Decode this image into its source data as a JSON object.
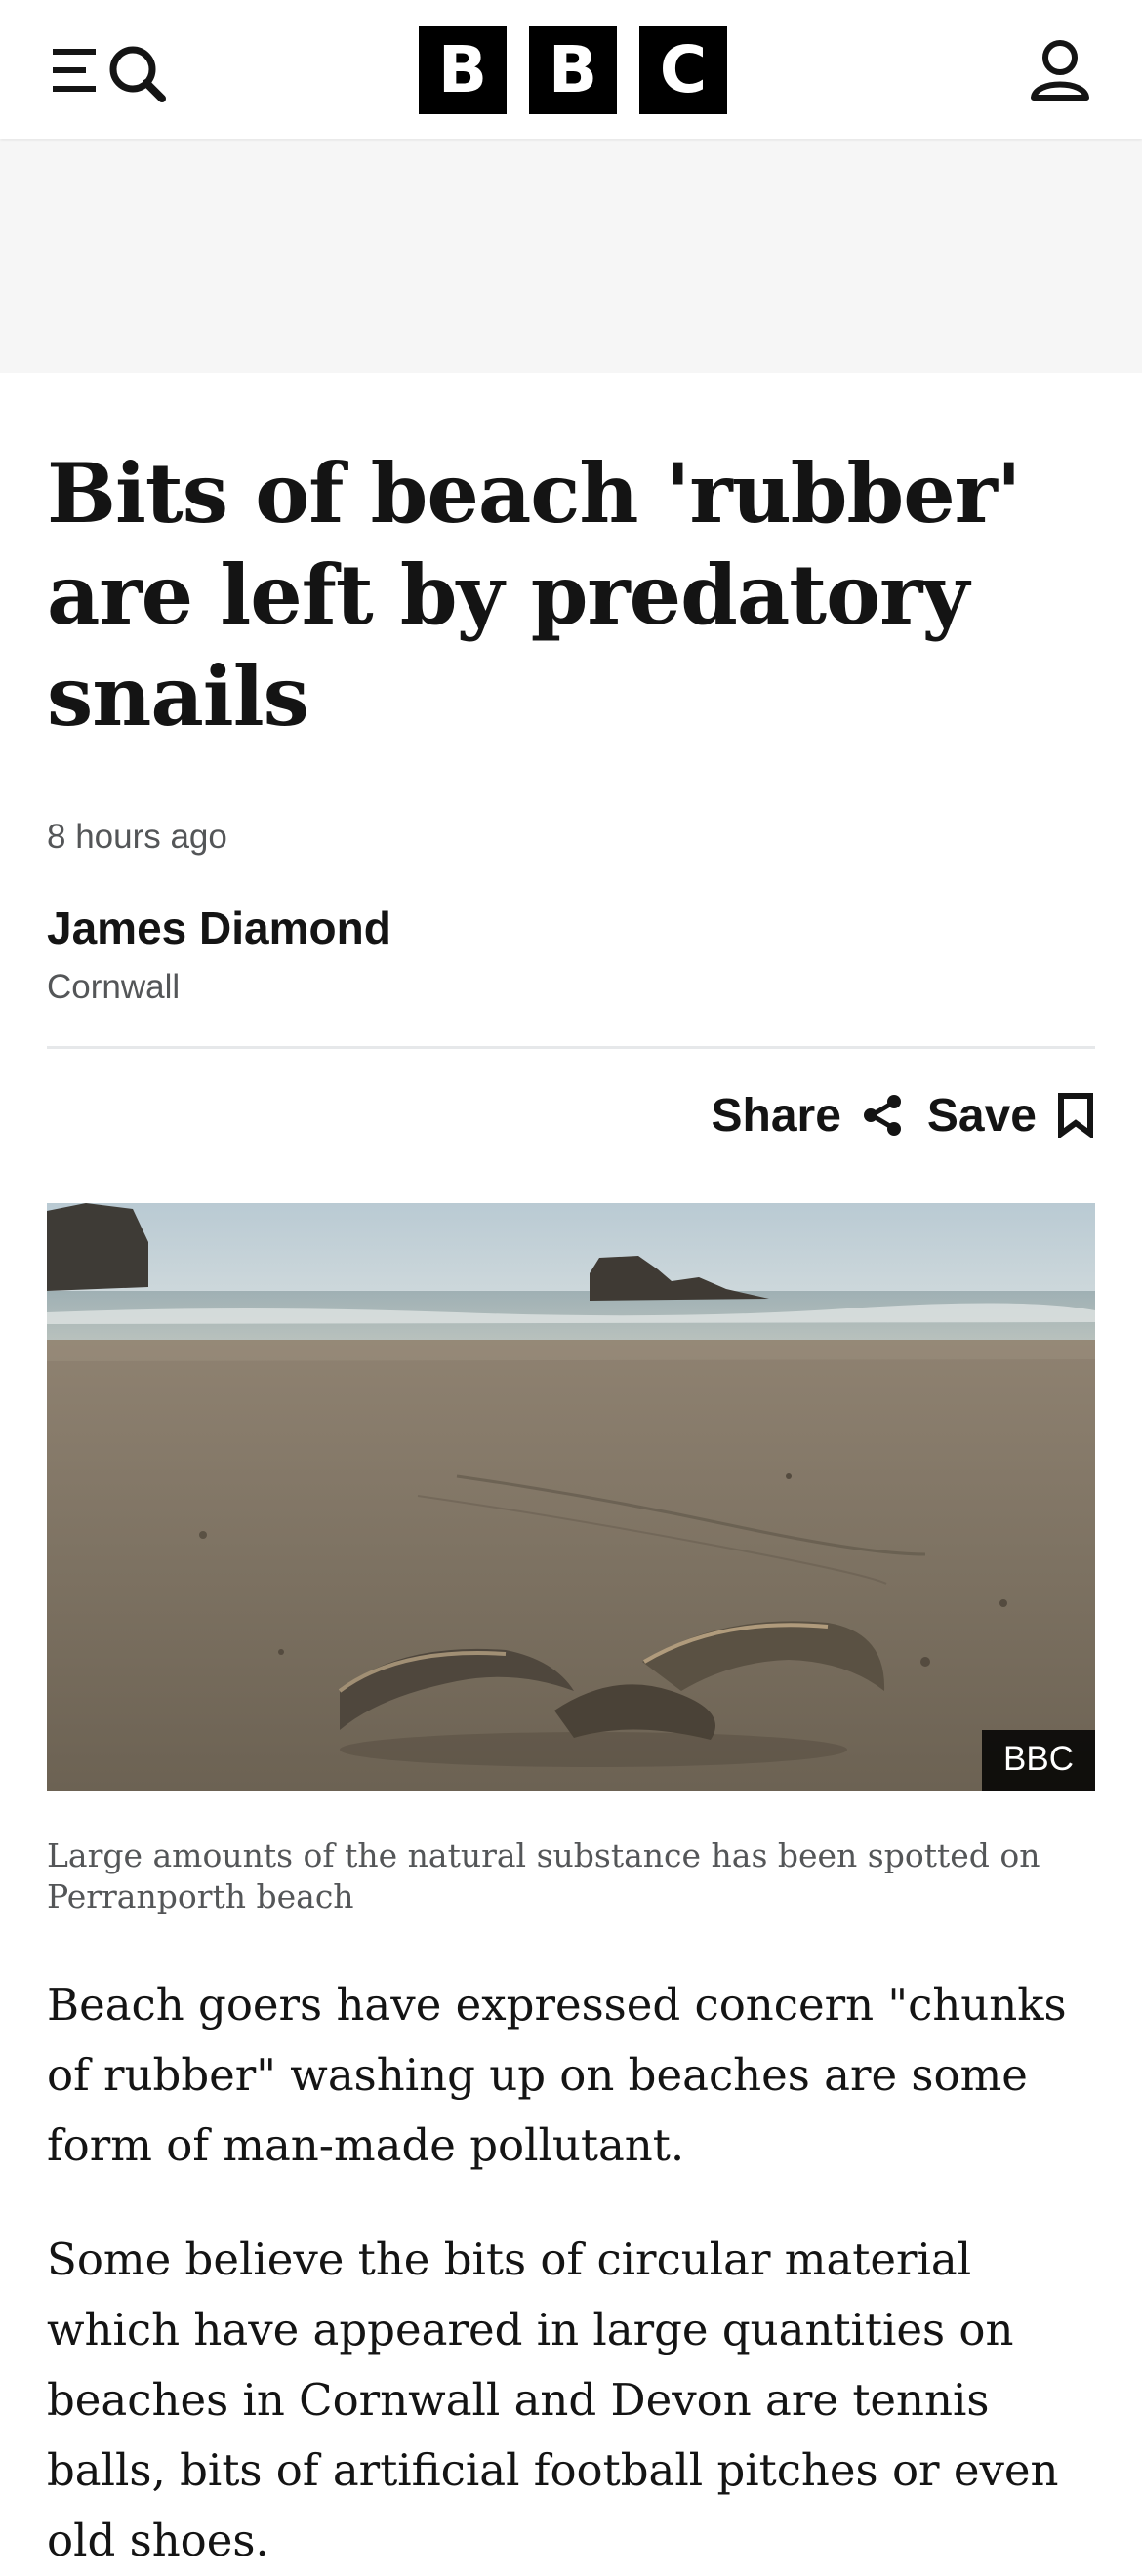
{
  "header": {
    "logo_letters": [
      "B",
      "B",
      "C"
    ],
    "menu_icon": "menu-search-icon",
    "account_icon": "account-icon"
  },
  "article": {
    "headline": "Bits of beach 'rubber' are left by predatory snails",
    "timestamp": "8 hours ago",
    "author": "James Diamond",
    "location": "Cornwall",
    "share_label": "Share",
    "save_label": "Save",
    "image_credit": "BBC",
    "image_caption": "Large amounts of the natural substance has been spotted on Perranporth beach",
    "paragraphs": [
      "Beach goers have expressed concern \"chunks of rubber\" washing up on beaches are some form of man-made pollutant.",
      "Some believe the bits of circular material which have appeared in large quantities on beaches in Cornwall and Devon are tennis balls, bits of artificial football pitches or even old shoes."
    ]
  },
  "colors": {
    "text": "#141414",
    "meta_text": "#545658",
    "divider": "#e6e8ea",
    "ad_background": "#f6f6f6",
    "logo": "#000000"
  }
}
